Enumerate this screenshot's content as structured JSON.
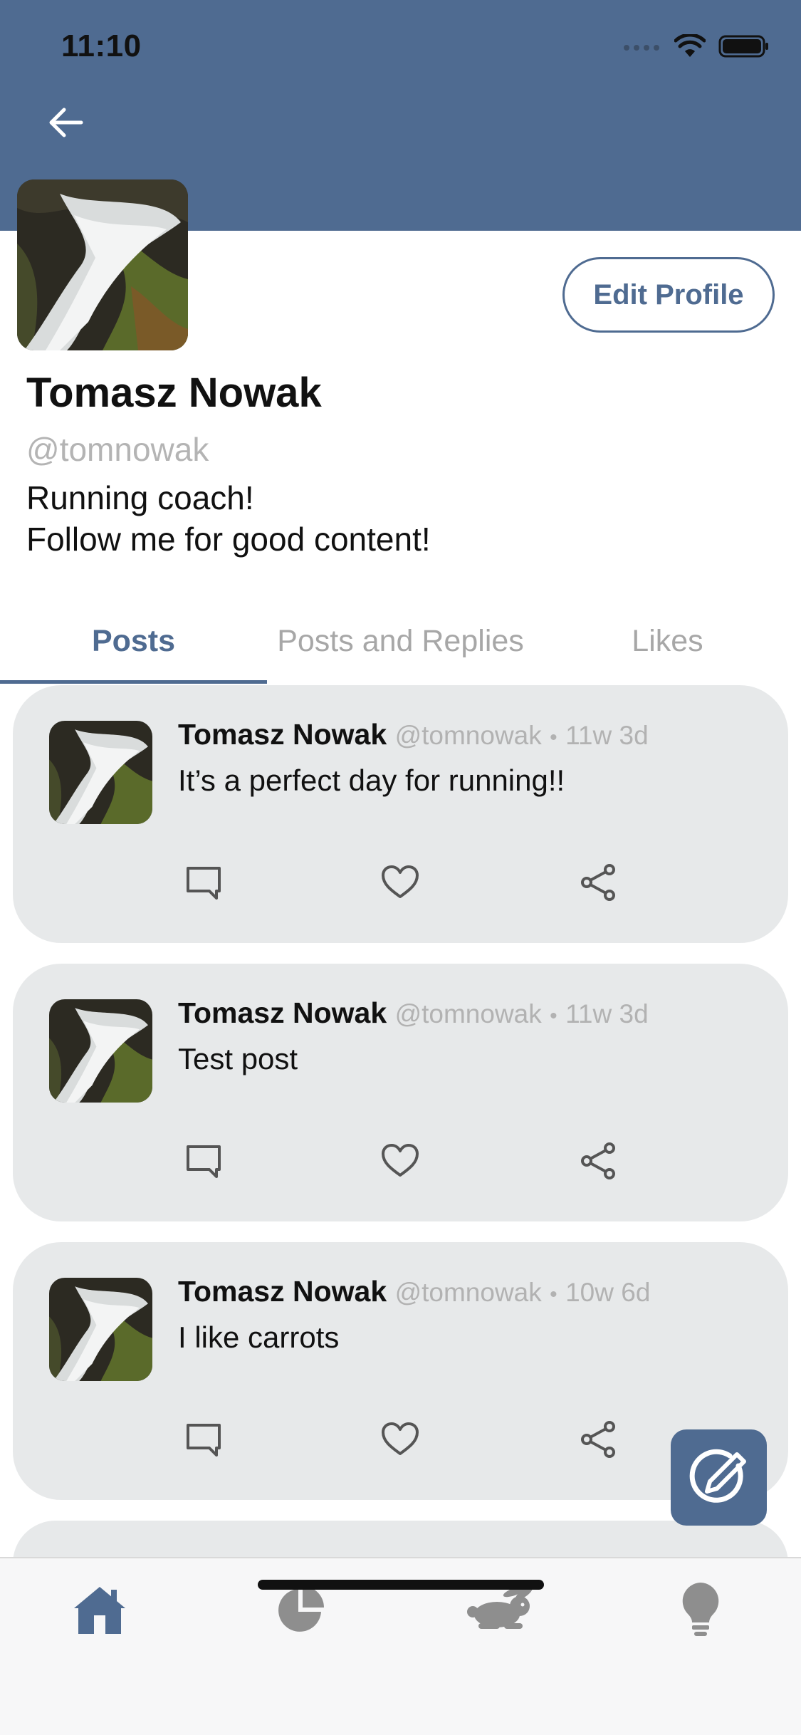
{
  "status": {
    "time": "11:10"
  },
  "profile": {
    "name": "Tomasz Nowak",
    "handle": "@tomnowak",
    "bio": "Running coach!\nFollow me for good content!",
    "edit_label": "Edit Profile"
  },
  "tabs": [
    {
      "label": "Posts",
      "active": true
    },
    {
      "label": "Posts and Replies",
      "active": false
    },
    {
      "label": "Likes",
      "active": false
    }
  ],
  "posts": [
    {
      "name": "Tomasz Nowak",
      "handle": "@tomnowak",
      "separator": "•",
      "time": "11w 3d",
      "text": "It’s a perfect day for running!!"
    },
    {
      "name": "Tomasz Nowak",
      "handle": "@tomnowak",
      "separator": "•",
      "time": "11w 3d",
      "text": "Test post"
    },
    {
      "name": "Tomasz Nowak",
      "handle": "@tomnowak",
      "separator": "•",
      "time": "10w 6d",
      "text": "I like carrots"
    }
  ],
  "bottom_nav": [
    {
      "icon": "home-icon",
      "active": true
    },
    {
      "icon": "pie-chart-icon",
      "active": false
    },
    {
      "icon": "rabbit-icon",
      "active": false
    },
    {
      "icon": "lightbulb-icon",
      "active": false
    }
  ],
  "colors": {
    "accent": "#4f6b91",
    "card_bg": "#e7e9ea",
    "muted_text": "#b2b2b2",
    "inactive_icon": "#8e8e8e"
  }
}
